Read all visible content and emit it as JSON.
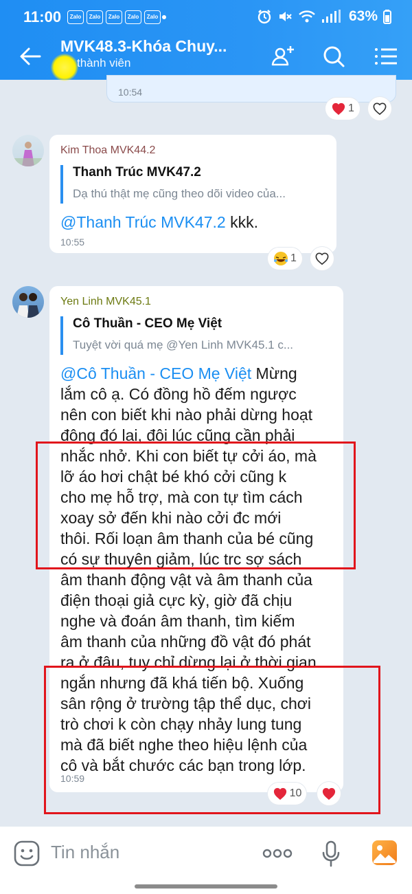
{
  "status_bar": {
    "time": "11:00",
    "zalo_badges": [
      "Zalo",
      "Zalo",
      "Zalo",
      "Zalo",
      "Zalo"
    ],
    "battery": "63%"
  },
  "header": {
    "title": "MVK48.3-Khóa Chuy...",
    "subtitle": "thành viên"
  },
  "messages": [
    {
      "time": "10:54",
      "reaction_count": "1"
    },
    {
      "sender": "Kim Thoa MVK44.2",
      "quote_name": "Thanh Trúc MVK47.2",
      "quote_text": "Dạ thú thật mẹ cũng theo dõi video của...",
      "mention": "@Thanh Trúc MVK47.2",
      "text": " kkk.",
      "time": "10:55",
      "reaction_count": "1"
    },
    {
      "sender": "Yen Linh MVK45.1",
      "quote_name": "Cô Thuần - CEO Mẹ Việt",
      "quote_text": "Tuyệt vời quá mẹ @Yen Linh MVK45.1 c...",
      "mention": "@Cô Thuần - CEO Mẹ Việt",
      "lines": [
        " Mừng",
        "lắm cô ạ. Có đồng hồ đếm ngược",
        "nên con biết khi nào phải dừng hoạt",
        "động đó lại, đôi lúc cũng cần phải",
        "nhắc nhở. Khi con biết tự cởi áo, mà",
        "lỡ áo hơi chật bé khó cởi cũng k",
        "cho mẹ hỗ trợ, mà con tự tìm cách",
        "xoay sở đến khi nào cởi đc mới",
        "thôi. Rối loạn âm thanh của bé cũng",
        "có sự thuyên giảm, lúc trc sợ sách",
        "âm thanh động vật và âm thanh của",
        "điện thoại giả cực kỳ, giờ đã chịu",
        "nghe và đoán âm thanh, tìm kiếm",
        "âm thanh của những đồ vật đó phát",
        "ra ở đâu, tuy chỉ dừng lại ở thời gian",
        "ngắn nhưng đã khá tiến bộ. Xuống",
        "sân rộng ở trường tập thể dục, chơi",
        "trò chơi k còn chạy nhảy lung tung",
        "mà đã biết nghe theo hiệu lệnh của",
        "cô và bắt chước các bạn trong lớp."
      ],
      "time": "10:59",
      "reaction_count": "10"
    }
  ],
  "input": {
    "placeholder": "Tin nhắn"
  },
  "colors": {
    "header_blue": "#2a95f5",
    "mention_blue": "#1a8ef2",
    "highlight_red": "#e1151c",
    "chat_background": "#e2e9f1"
  },
  "icons": [
    "back-arrow-icon",
    "add-member-icon",
    "search-icon",
    "menu-list-icon",
    "heart-icon",
    "laugh-emoji-icon",
    "sticker-icon",
    "more-icon",
    "microphone-icon",
    "image-gallery-icon"
  ]
}
